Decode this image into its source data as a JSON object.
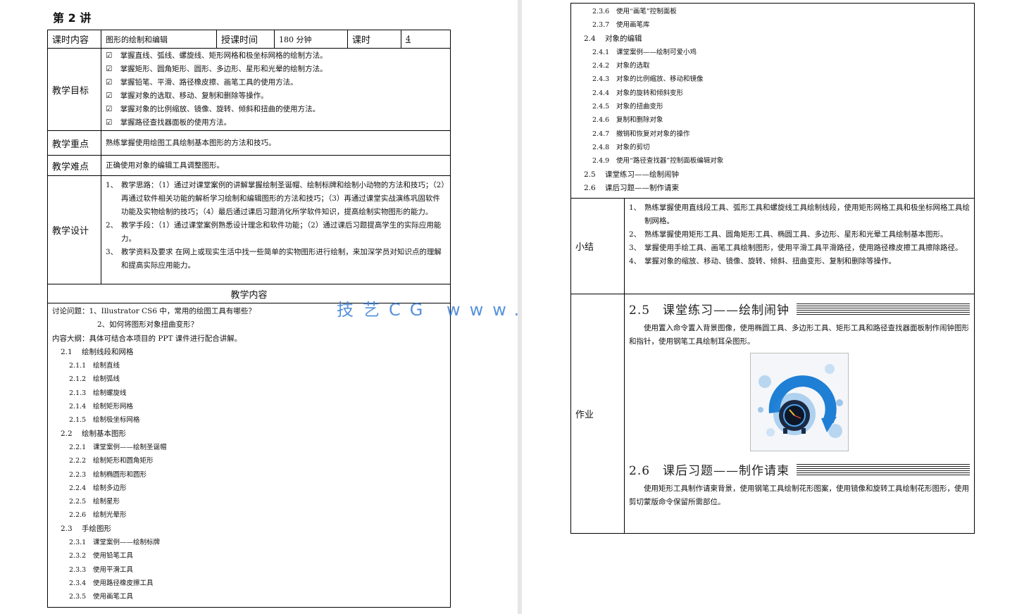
{
  "lecture_title": "第 2 讲",
  "header": {
    "label_course": "课时内容",
    "course": "图形的绘制和编辑",
    "label_time": "授课时间",
    "time": "180 分钟",
    "label_hours": "课时",
    "hours": "4"
  },
  "goals": {
    "label": "教学目标",
    "checkbox_glyph": "☑",
    "items": [
      "掌握直线、弧线、螺旋线、矩形网格和极坐标网格的绘制方法。",
      "掌握矩形、圆角矩形、圆形、多边形、星形和光晕的绘制方法。",
      "掌握铅笔、平滑、路径橡皮擦、画笔工具的使用方法。",
      "掌握对象的选取、移动、复制和删除等操作。",
      "掌握对象的比例缩放、镜像、旋转、倾斜和扭曲的使用方法。",
      "掌握路径查找器面板的使用方法。"
    ]
  },
  "key_points": {
    "label": "教学重点",
    "text": "熟练掌握使用绘图工具绘制基本图形的方法和技巧。"
  },
  "difficulties": {
    "label": "教学难点",
    "text": "正确使用对象的编辑工具调整图形。"
  },
  "design": {
    "label": "教学设计",
    "items": [
      {
        "num": "1、",
        "text": "教学思路：（1）通过对课堂案例的讲解掌握绘制圣诞帽、绘制标牌和绘制小动物的方法和技巧；（2）再通过软件相关功能的解析学习绘制和编辑图形的方法和技巧；（3）再通过课堂实战演练巩固软件功能及实物绘制的技巧；（4）最后通过课后习题消化所学软件知识，提高绘制实物图形的能力。"
      },
      {
        "num": "2、",
        "text": "教学手段：（1）通过课堂案例熟悉设计理念和软件功能；（2）通过课后习题提高学生的实际应用能力。"
      },
      {
        "num": "3、",
        "text": "教学资料及要求 在网上或现实生活中找一些简单的实物图形进行绘制，来加深学员对知识点的理解和提高实际应用能力。"
      }
    ]
  },
  "content": {
    "heading": "教学内容",
    "discussion_1": "讨论问题：1、Illustrator CS6 中，常用的绘图工具有哪些？",
    "discussion_2": "2、如何将图形对象扭曲变形？",
    "outline_intro": "内容大纲：具体可结合本项目的 PPT 课件进行配合讲解。",
    "outline_left": [
      {
        "level": 1,
        "num": "2.1",
        "text": "绘制线段和网格"
      },
      {
        "level": 2,
        "num": "2.1.1",
        "text": "绘制直线"
      },
      {
        "level": 2,
        "num": "2.1.2",
        "text": "绘制弧线"
      },
      {
        "level": 2,
        "num": "2.1.3",
        "text": "绘制螺旋线"
      },
      {
        "level": 2,
        "num": "2.1.4",
        "text": "绘制矩形网格"
      },
      {
        "level": 2,
        "num": "2.1.5",
        "text": "绘制极坐标网格"
      },
      {
        "level": 1,
        "num": "2.2",
        "text": "绘制基本图形"
      },
      {
        "level": 2,
        "num": "2.2.1",
        "text": "课堂案例——绘制圣诞帽"
      },
      {
        "level": 2,
        "num": "2.2.2",
        "text": "绘制矩形和圆角矩形"
      },
      {
        "level": 2,
        "num": "2.2.3",
        "text": "绘制椭圆形和圆形"
      },
      {
        "level": 2,
        "num": "2.2.4",
        "text": "绘制多边形"
      },
      {
        "level": 2,
        "num": "2.2.5",
        "text": "绘制星形"
      },
      {
        "level": 2,
        "num": "2.2.6",
        "text": "绘制光晕形"
      },
      {
        "level": 1,
        "num": "2.3",
        "text": "手绘图形"
      },
      {
        "level": 2,
        "num": "2.3.1",
        "text": "课堂案例——绘制标牌"
      },
      {
        "level": 2,
        "num": "2.3.2",
        "text": "使用铅笔工具"
      },
      {
        "level": 2,
        "num": "2.3.3",
        "text": "使用平滑工具"
      },
      {
        "level": 2,
        "num": "2.3.4",
        "text": "使用路径橡皮擦工具"
      },
      {
        "level": 2,
        "num": "2.3.5",
        "text": "使用画笔工具"
      }
    ],
    "outline_right": [
      {
        "level": 2,
        "num": "2.3.6",
        "text": "使用“画笔”控制面板"
      },
      {
        "level": 2,
        "num": "2.3.7",
        "text": "使用画笔库"
      },
      {
        "level": 1,
        "num": "2.4",
        "text": "对象的编辑"
      },
      {
        "level": 2,
        "num": "2.4.1",
        "text": "课堂案例——绘制可爱小鸡"
      },
      {
        "level": 2,
        "num": "2.4.2",
        "text": "对象的选取"
      },
      {
        "level": 2,
        "num": "2.4.3",
        "text": "对象的比例缩放、移动和镜像"
      },
      {
        "level": 2,
        "num": "2.4.4",
        "text": "对象的旋转和倾斜变形"
      },
      {
        "level": 2,
        "num": "2.4.5",
        "text": "对象的扭曲变形"
      },
      {
        "level": 2,
        "num": "2.4.6",
        "text": "复制和删除对象"
      },
      {
        "level": 2,
        "num": "2.4.7",
        "text": "撤销和恢复对对象的操作"
      },
      {
        "level": 2,
        "num": "2.4.8",
        "text": "对象的剪切"
      },
      {
        "level": 2,
        "num": "2.4.9",
        "text": "使用“路径查找器”控制面板编辑对象"
      },
      {
        "level": 1,
        "num": "2.5",
        "text": "课堂练习——绘制闹钟"
      },
      {
        "level": 1,
        "num": "2.6",
        "text": "课后习题——制作请柬"
      }
    ]
  },
  "summary": {
    "label": "小结",
    "items": [
      {
        "num": "1、",
        "text": "熟练掌握使用直线段工具、弧形工具和螺旋线工具绘制线段，使用矩形网格工具和极坐标网格工具绘制网格。"
      },
      {
        "num": "2、",
        "text": "熟练掌握使用矩形工具、圆角矩形工具、椭圆工具、多边形、星形和光晕工具绘制基本图形。"
      },
      {
        "num": "3、",
        "text": "掌握使用手绘工具、画笔工具绘制图形，使用平滑工具平滑路径，使用路径橡皮擦工具擦除路径。"
      },
      {
        "num": "4、",
        "text": "掌握对象的缩放、移动、镜像、旋转、倾斜、扭曲变形、复制和删除等操作。"
      }
    ]
  },
  "homework": {
    "label": "作业",
    "ex1_title": "2.5　课堂练习——绘制闹钟",
    "ex1_text": "使用置入命令置入背景图像，使用椭圆工具、多边形工具、矩形工具和路径查找器面板制作闹钟图形和指针，使用钢笔工具绘制耳朵图形。",
    "ex2_title": "2.6　课后习题——制作请柬",
    "ex2_text": "使用矩形工具制作请柬背景，使用钢笔工具绘制花形图案，使用镜像和旋转工具绘制花形图形，使用剪切蒙版命令保留所需部位。"
  },
  "watermark": "技艺CG www.qdnxxfb.cn",
  "colors": {
    "watermark": "#3b7fd6",
    "clock_blue": "#1f7fd4",
    "clock_dark": "#1b2a44"
  }
}
